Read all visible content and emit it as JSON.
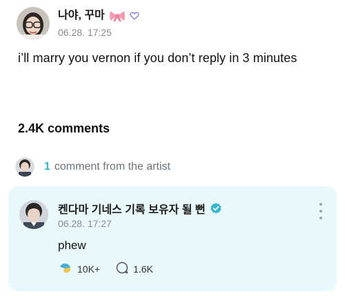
{
  "post": {
    "author": "나야, 꾸마",
    "time": "06.28. 17:25",
    "text": "i’ll marry you vernon if you don’t reply in 3 minutes",
    "comment_count": "2.4K comments"
  },
  "artist_summary": {
    "count": "1",
    "label": "comment from the artist"
  },
  "artist_comment": {
    "author": "켄다마 기네스 기록 보유자 될 뻔",
    "time": "06.28. 17:27",
    "text": "phew",
    "likes": "10K+",
    "replies": "1.6K"
  },
  "colors": {
    "accent": "#3ab0c8",
    "card_background": "#e9f9fb",
    "verified": "#38b6d0"
  },
  "icons": {
    "ribbon": "ribbon-icon",
    "heart": "heart-icon",
    "verified": "verified-badge-icon",
    "like": "like-icon",
    "reply": "comment-bubble-icon",
    "more": "more-vertical-icon"
  }
}
